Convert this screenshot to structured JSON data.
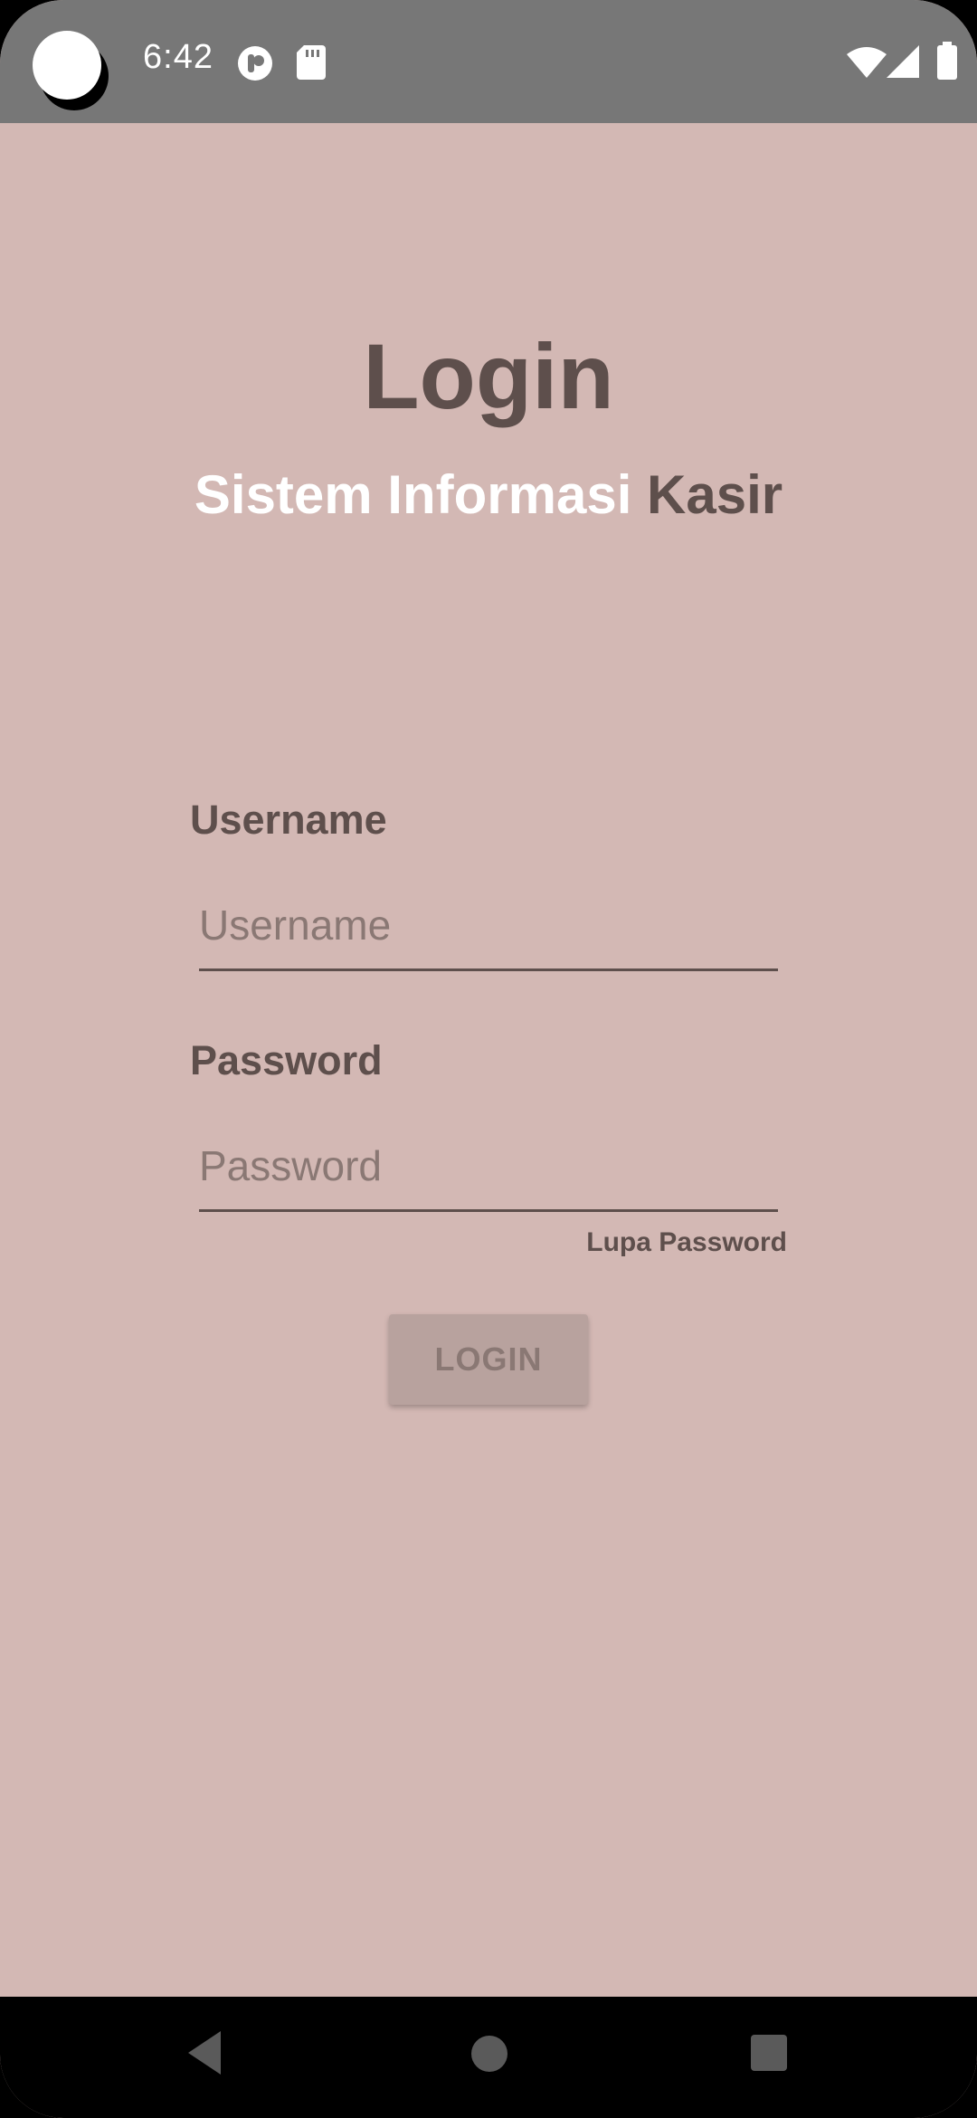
{
  "status_bar": {
    "time": "6:42",
    "icons": [
      "circle-camera-icon",
      "app-notification-icon",
      "sd-card-icon",
      "wifi-icon",
      "signal-icon",
      "battery-icon"
    ]
  },
  "login": {
    "title": "Login",
    "subtitle_light": "Sistem Informasi ",
    "subtitle_dark": "Kasir",
    "username_label": "Username",
    "username_placeholder": "Username",
    "password_label": "Password",
    "password_placeholder": "Password",
    "forgot_password": "Lupa Password",
    "login_button": "LOGIN"
  },
  "colors": {
    "background": "#d3b8b4",
    "text_dark": "#5e4f4c",
    "status_bar": "#777777",
    "button": "#b8a29e"
  },
  "nav_bar": {
    "buttons": [
      "back-icon",
      "home-icon",
      "recents-icon"
    ]
  }
}
